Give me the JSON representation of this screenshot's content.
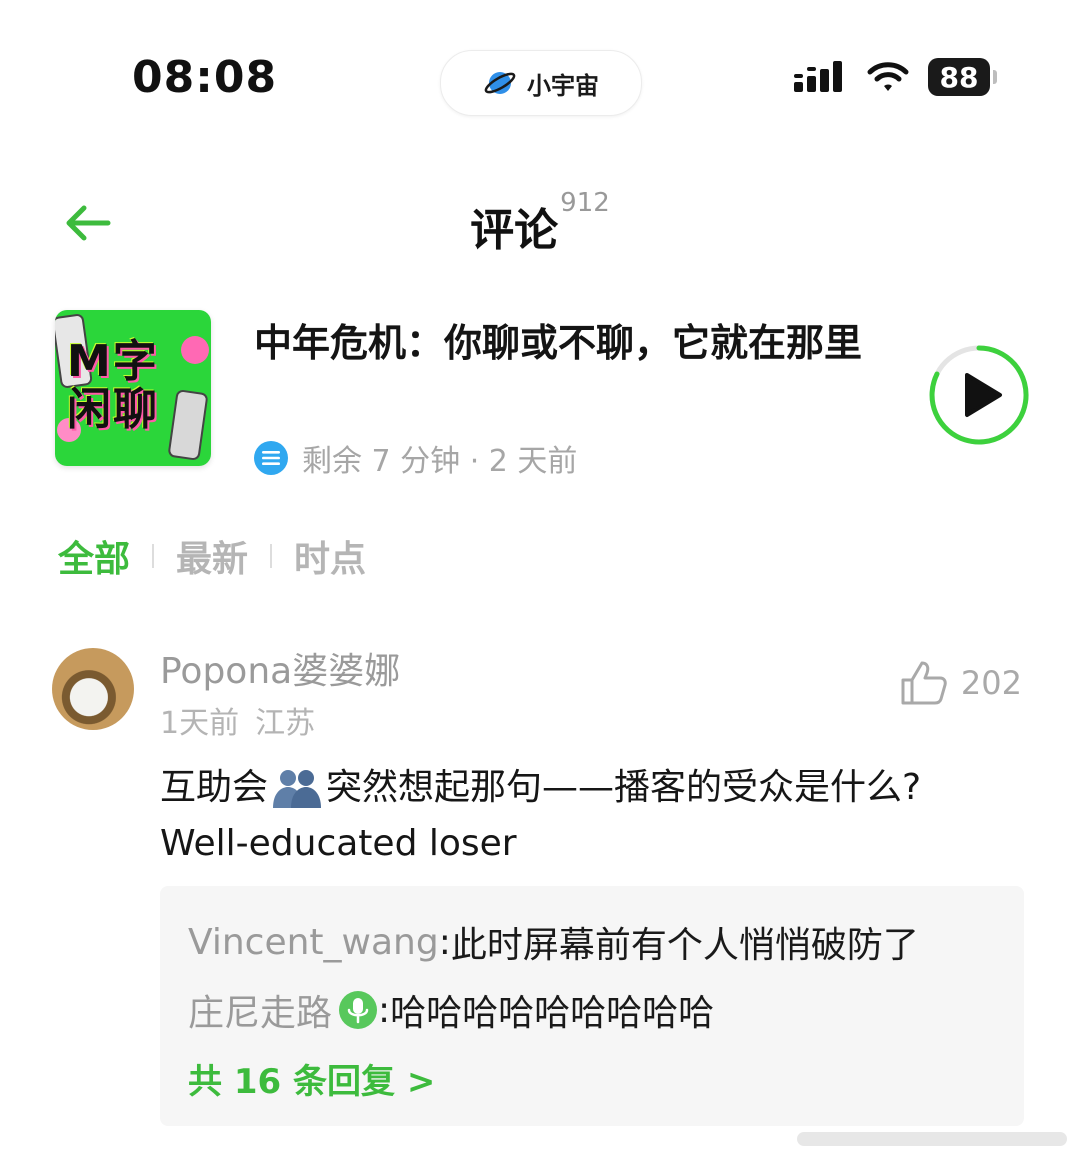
{
  "status_bar": {
    "time": "08:08",
    "brand_label": "小宇宙",
    "battery_level": "88"
  },
  "header": {
    "title": "评论",
    "comment_count": "912"
  },
  "episode": {
    "cover_text": "M字 闲聊",
    "title": "中年危机：你聊或不聊，它就在那里",
    "remaining": "剩余 7 分钟",
    "separator": " · ",
    "published": "2 天前"
  },
  "tabs": [
    {
      "label": "全部",
      "active": true
    },
    {
      "label": "最新",
      "active": false
    },
    {
      "label": "时点",
      "active": false
    }
  ],
  "comment": {
    "username": "Popona婆婆娜",
    "time": "1天前",
    "location": "江苏",
    "likes": "202",
    "text_part1": "互助会",
    "text_part2": "突然想起那句——播客的受众是什么?",
    "text_line2": "Well-educated loser",
    "replies": [
      {
        "user": "Vincent_wang",
        "text": "此时屏幕前有个人悄悄破防了"
      },
      {
        "user": "庄尼走路",
        "text": "哈哈哈哈哈哈哈哈哈"
      }
    ],
    "view_more": "共 16 条回复 >"
  },
  "colors": {
    "accent_green": "#3dbb3d",
    "meta_icon_blue": "#30a8f0"
  },
  "icons": [
    "back-arrow-icon",
    "planet-icon",
    "signal-icon",
    "wifi-icon",
    "play-icon",
    "list-icon",
    "thumbs-up-icon",
    "hugging-people-icon",
    "microphone-icon"
  ]
}
